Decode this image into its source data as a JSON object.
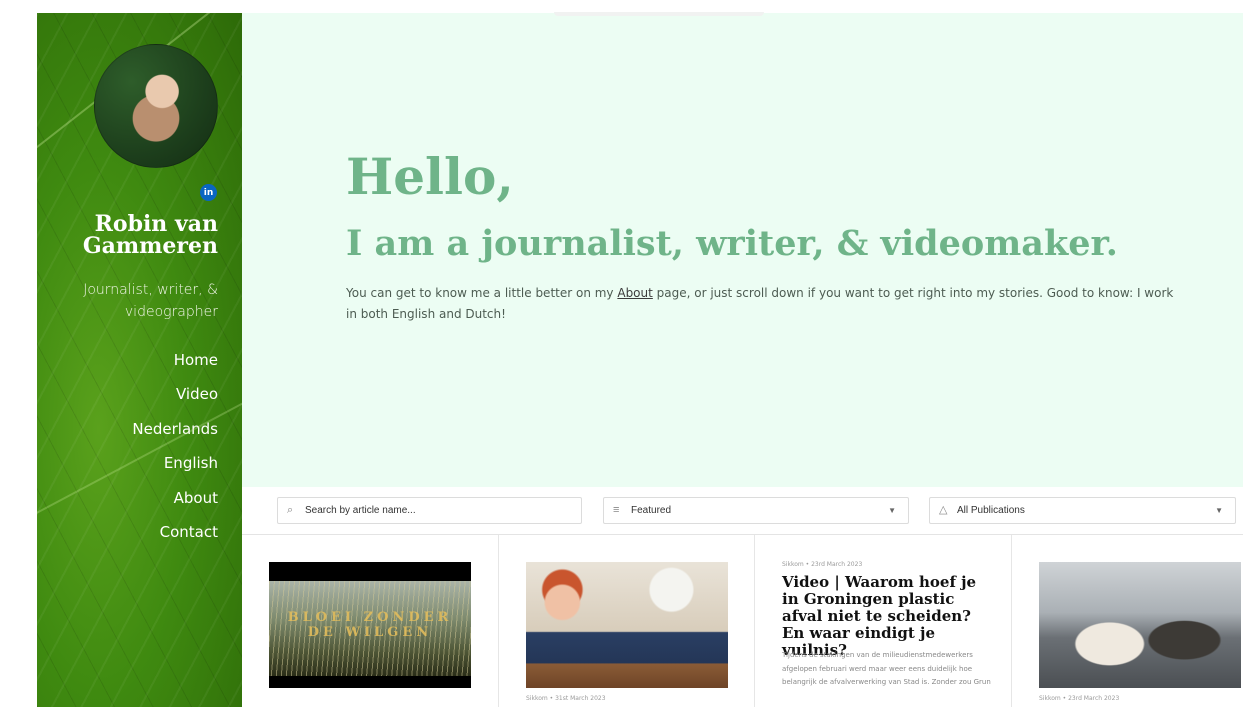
{
  "sidebar": {
    "social_label": "in",
    "name": "Robin van Gammeren",
    "tagline": "Journalist, writer, & videographer",
    "nav": [
      "Home",
      "Video",
      "Nederlands",
      "English",
      "About",
      "Contact"
    ]
  },
  "hero": {
    "hello": "Hello,",
    "subhead": "I am a journalist, writer, & videomaker.",
    "intro_before": "You can get to know me a little better on my ",
    "intro_link": "About",
    "intro_after": " page, or just scroll down if you want to get right into my stories. Good to know: I work in both English and Dutch!"
  },
  "filters": {
    "search_placeholder": "Search by article name...",
    "sort_label": "Featured",
    "publication_label": "All Publications"
  },
  "cards": [
    {
      "thumb_text": "BLOEI ZONDER DE WILGEN",
      "meta": ""
    },
    {
      "meta": "Sikkom • 31st March 2023"
    },
    {
      "meta": "Sikkom • 23rd March 2023",
      "title": "Video | Waarom hoef je in Groningen plastic afval niet te scheiden? En waar eindigt je vuilnis?",
      "excerpt": "Tijdens de stakingen van de milieudienstmedewerkers afgelopen februari werd maar weer eens duidelijk hoe belangrijk de afvalverwerking van Stad is. Zonder zou Grun"
    },
    {
      "meta": "Sikkom • 23rd March 2023"
    }
  ],
  "colors": {
    "sidebar_green": "#3f8a10",
    "hero_bg": "#ecfdf3",
    "hero_heading": "#6fb489",
    "linkedin": "#0a66c2"
  },
  "icons": {
    "search": "search-icon",
    "sort": "sort-lines-icon",
    "publication": "shapes-icon",
    "dropdown": "chevron-down-icon",
    "social": "linkedin-icon"
  }
}
